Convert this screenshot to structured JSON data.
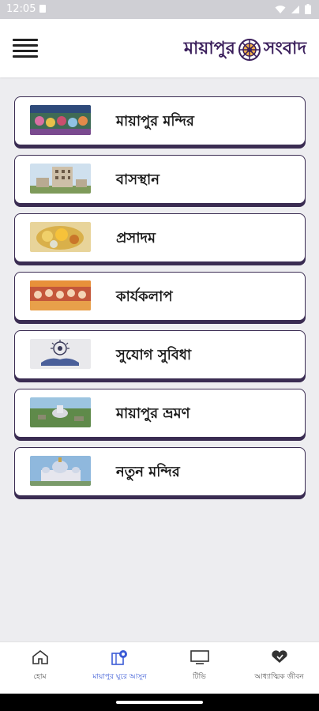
{
  "status": {
    "time": "12:05"
  },
  "brand": {
    "word1": "মায়াপুর",
    "word2": "সংবাদ"
  },
  "menu": [
    {
      "label": "মায়াপুর মন্দির",
      "thumb": "temple-deities"
    },
    {
      "label": "বাসস্থান",
      "thumb": "building"
    },
    {
      "label": "প্রসাদম",
      "thumb": "food"
    },
    {
      "label": "কার্যকলাপ",
      "thumb": "activities"
    },
    {
      "label": "সুযোগ সুবিধা",
      "thumb": "facilities"
    },
    {
      "label": "মায়াপুর ভ্রমণ",
      "thumb": "aerial-view"
    },
    {
      "label": "নতুন মন্দির",
      "thumb": "new-temple"
    }
  ],
  "nav": [
    {
      "label": "হোম",
      "icon": "home-icon",
      "active": false
    },
    {
      "label": "মায়াপুর ঘুরে আসুন",
      "icon": "map-pin-icon",
      "active": true
    },
    {
      "label": "টিভি",
      "icon": "tv-icon",
      "active": false
    },
    {
      "label": "আধ্যাত্মিক জীবন",
      "icon": "heart-hands-icon",
      "active": false
    }
  ],
  "colors": {
    "accent": "#3b5bd6",
    "card_border": "#3a2c52",
    "brand": "#3b1f5c"
  }
}
